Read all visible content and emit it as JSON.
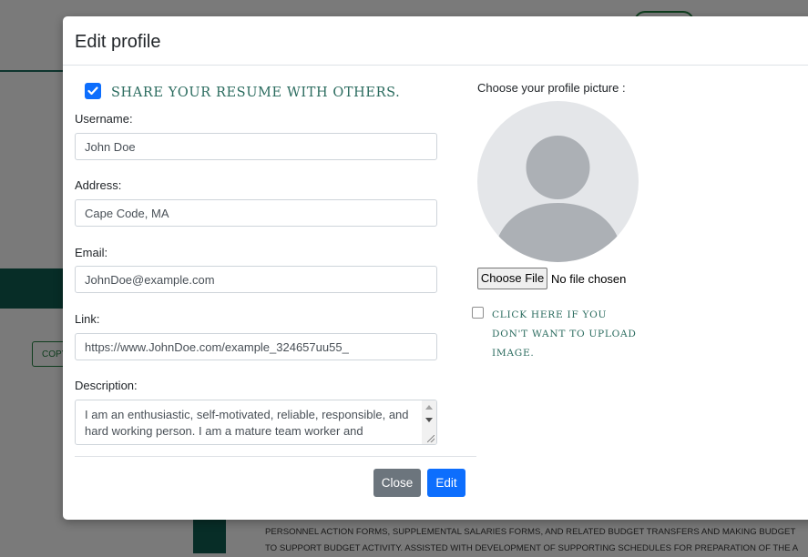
{
  "background": {
    "copy_button_label": "COPY",
    "text_lines": [
      "Personnel action forms, supplemental salaries forms, and related budget transfers and making budget",
      "to support budget activity. Assisted with development of supporting schedules for preparation of the a"
    ]
  },
  "modal": {
    "title": "Edit profile",
    "share": {
      "checked": true,
      "label": "Share your resume with others."
    },
    "fields": {
      "username": {
        "label": "Username:",
        "value": "John Doe"
      },
      "address": {
        "label": "Address:",
        "value": "Cape Code, MA"
      },
      "email": {
        "label": "Email:",
        "value": "JohnDoe@example.com"
      },
      "link": {
        "label": "Link:",
        "value": "https://www.JohnDoe.com/example_324657uu55_"
      },
      "description": {
        "label": "Description:",
        "value": "I am an enthusiastic, self-motivated, reliable, responsible, and hard working person. I am a mature team worker and"
      }
    },
    "picture": {
      "label": "Choose your profile picture :",
      "choose_file_label": "Choose File",
      "file_status": "No file chosen",
      "no_upload_label": "Click here if you don't want to upload image."
    },
    "buttons": {
      "close": "Close",
      "edit": "Edit"
    }
  },
  "colors": {
    "primary": "#0d6efd",
    "secondary": "#6c757d",
    "accent_green": "#2a6b5e"
  },
  "icons": {
    "share_checkbox": "checkmark-icon",
    "avatar": "user-silhouette-icon"
  }
}
